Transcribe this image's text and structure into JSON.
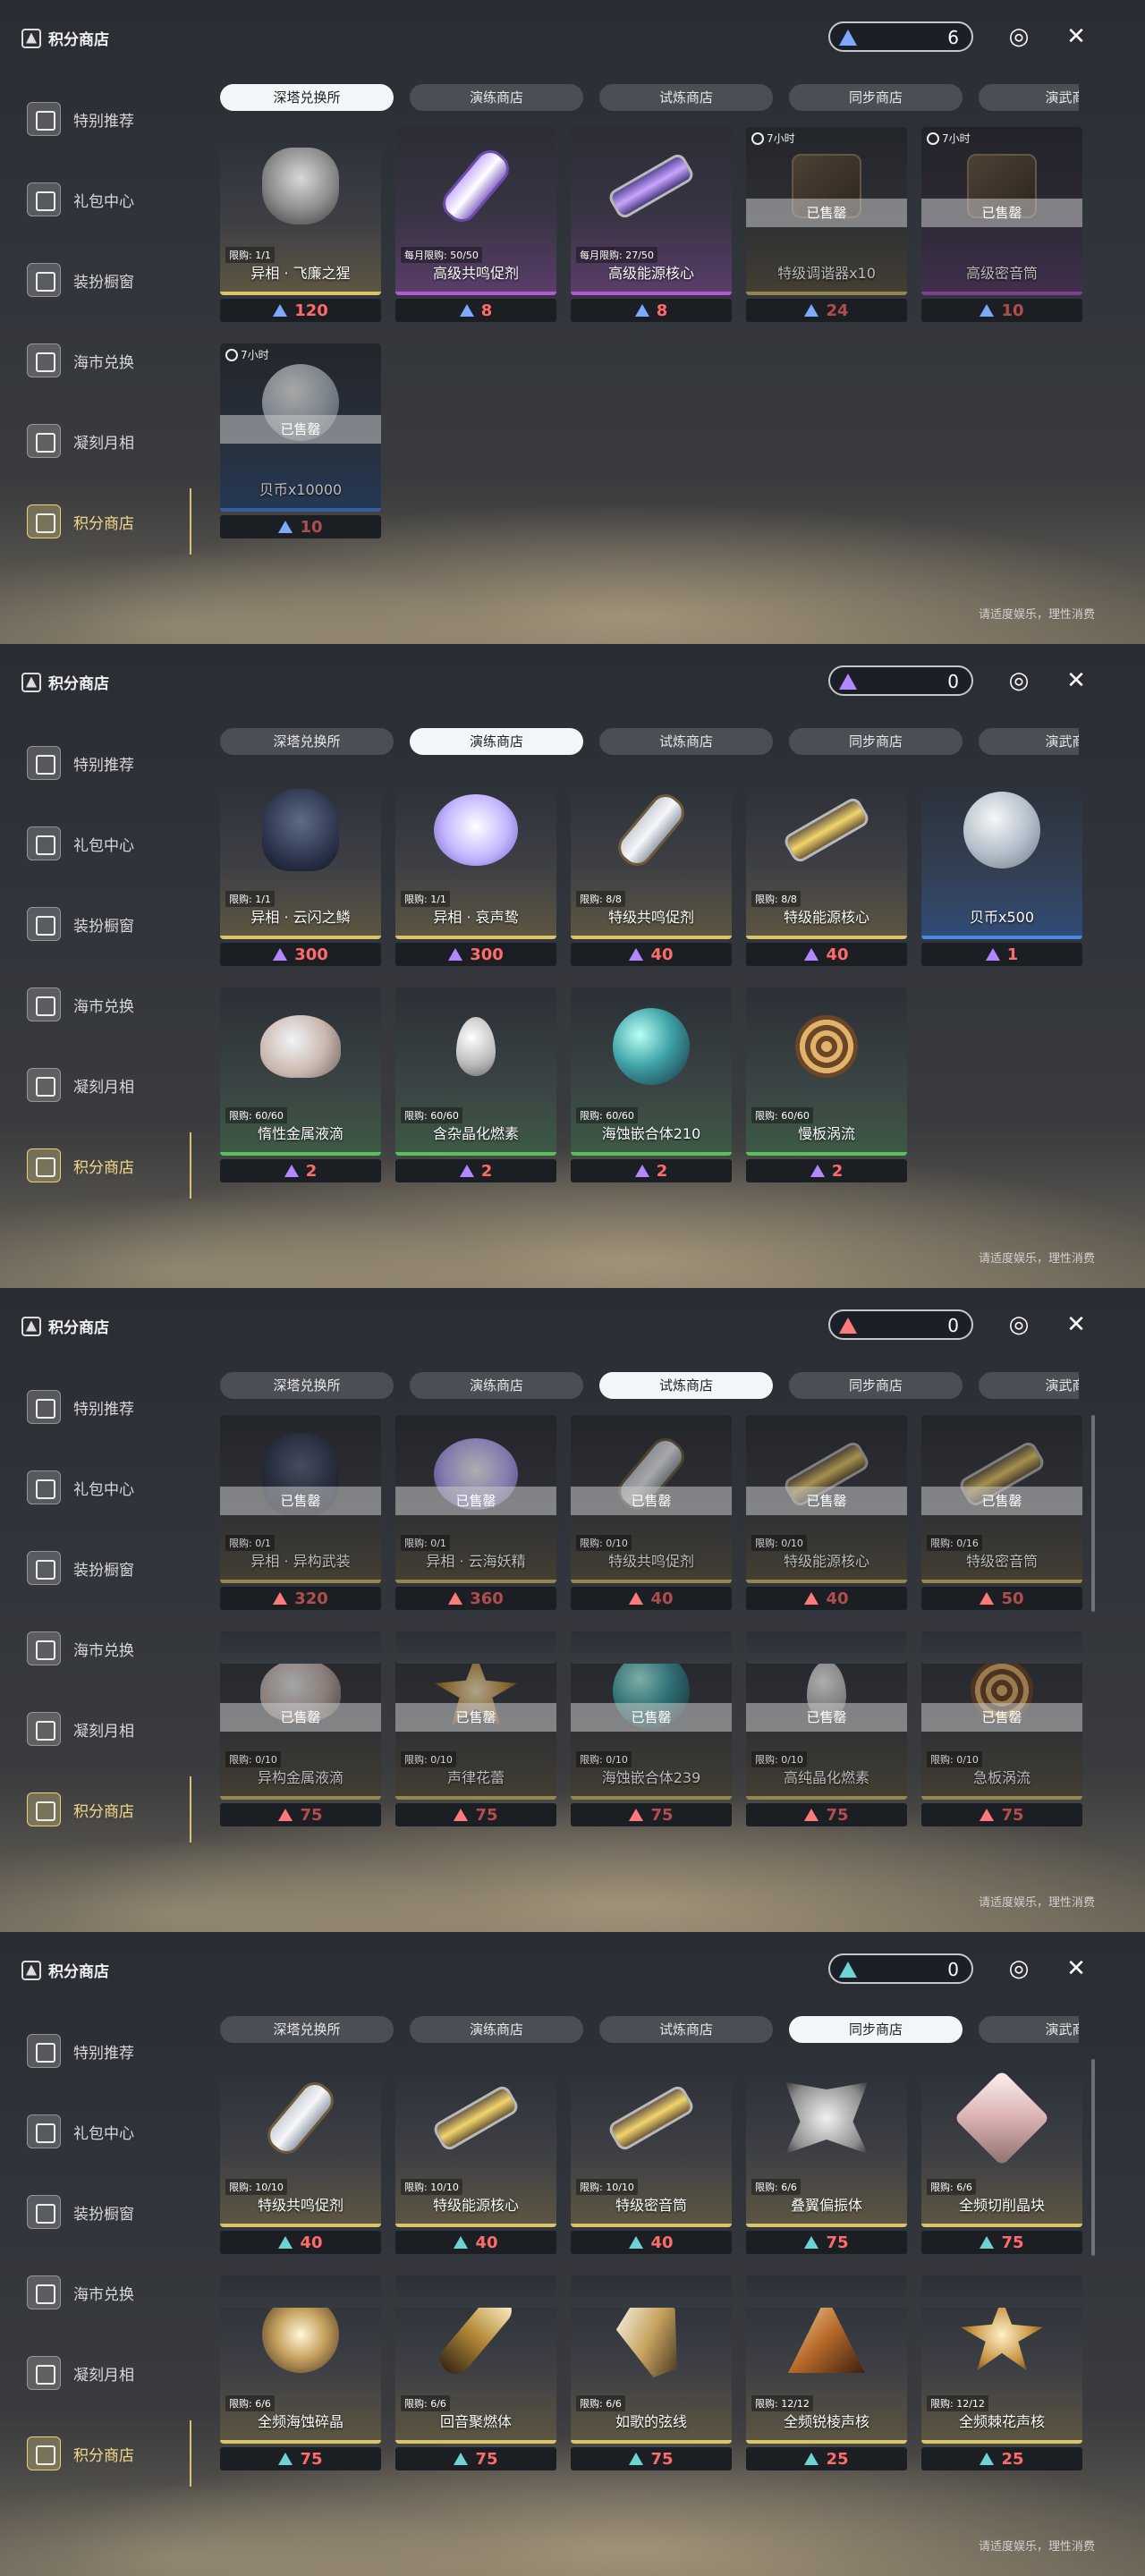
{
  "common": {
    "page_title": "积分商店",
    "notice": "请适度娱乐，理性消费",
    "sidebar": [
      {
        "label": "特别推荐",
        "active": false,
        "icon": "star-icon"
      },
      {
        "label": "礼包中心",
        "active": false,
        "icon": "gift-icon"
      },
      {
        "label": "装扮橱窗",
        "active": false,
        "icon": "wardrobe-icon"
      },
      {
        "label": "海市兑换",
        "active": false,
        "icon": "market-icon"
      },
      {
        "label": "凝刻月相",
        "active": false,
        "icon": "moon-icon"
      },
      {
        "label": "积分商店",
        "active": true,
        "icon": "points-shop-icon"
      }
    ],
    "tabs": [
      "深塔兑换所",
      "演练商店",
      "试炼商店",
      "同步商店",
      "演武商"
    ],
    "sold_label": "已售罄"
  },
  "panels": [
    {
      "currency_value": "6",
      "currency_color": "#7fa8ff",
      "active_tab": 0,
      "items": [
        {
          "name": "异相 · 飞廉之猩",
          "limit": "限购: 1/1",
          "price": "120",
          "art": "mask",
          "rarity": "gold",
          "sold": false
        },
        {
          "name": "高级共鸣促剂",
          "limit": "每月限购: 50/50",
          "price": "8",
          "art": "vial-purple",
          "rarity": "purple",
          "sold": false
        },
        {
          "name": "高级能源核心",
          "limit": "每月限购: 27/50",
          "price": "8",
          "art": "capsule-purple",
          "rarity": "purple",
          "sold": false
        },
        {
          "name": "特级调谐器x10",
          "timer": "7小时",
          "price": "24",
          "art": "box",
          "rarity": "gold",
          "sold": true
        },
        {
          "name": "高级密音筒",
          "timer": "7小时",
          "price": "10",
          "art": "box",
          "rarity": "purple",
          "sold": true
        },
        {
          "name": "贝币x10000",
          "timer": "7小时",
          "price": "10",
          "art": "disc",
          "rarity": "blue",
          "sold": true
        }
      ]
    },
    {
      "currency_value": "0",
      "currency_color": "#b188ff",
      "active_tab": 1,
      "items": [
        {
          "name": "异相 · 云闪之鳞",
          "limit": "限购: 1/1",
          "price": "300",
          "art": "helmet",
          "rarity": "gold",
          "sold": false
        },
        {
          "name": "异相 · 哀声鸷",
          "limit": "限购: 1/1",
          "price": "300",
          "art": "wing",
          "rarity": "gold",
          "sold": false
        },
        {
          "name": "特级共鸣促剂",
          "limit": "限购: 8/8",
          "price": "40",
          "art": "vial",
          "rarity": "gold",
          "sold": false
        },
        {
          "name": "特级能源核心",
          "limit": "限购: 8/8",
          "price": "40",
          "art": "capsule",
          "rarity": "gold",
          "sold": false
        },
        {
          "name": "贝币x500",
          "limit": "",
          "price": "1",
          "art": "disc",
          "rarity": "blue",
          "sold": false
        },
        {
          "name": "惰性金属液滴",
          "limit": "限购: 60/60",
          "price": "2",
          "art": "shell",
          "rarity": "green",
          "sold": false
        },
        {
          "name": "含杂晶化燃素",
          "limit": "限购: 60/60",
          "price": "2",
          "art": "drop",
          "rarity": "green",
          "sold": false
        },
        {
          "name": "海蚀嵌合体210",
          "limit": "限购: 60/60",
          "price": "2",
          "art": "crystal",
          "rarity": "green",
          "sold": false
        },
        {
          "name": "慢板涡流",
          "limit": "限购: 60/60",
          "price": "2",
          "art": "swirl",
          "rarity": "green",
          "sold": false
        }
      ]
    },
    {
      "currency_value": "0",
      "currency_color": "#ff7b7b",
      "active_tab": 2,
      "items": [
        {
          "name": "异相 · 异构武装",
          "limit": "限购: 0/1",
          "price": "320",
          "art": "helmet",
          "rarity": "gold",
          "sold": true
        },
        {
          "name": "异相 · 云海妖精",
          "limit": "限购: 0/1",
          "price": "360",
          "art": "wing",
          "rarity": "gold",
          "sold": true
        },
        {
          "name": "特级共鸣促剂",
          "limit": "限购: 0/10",
          "price": "40",
          "art": "vial",
          "rarity": "gold",
          "sold": true
        },
        {
          "name": "特级能源核心",
          "limit": "限购: 0/10",
          "price": "40",
          "art": "capsule",
          "rarity": "gold",
          "sold": true
        },
        {
          "name": "特级密音筒",
          "limit": "限购: 0/16",
          "price": "50",
          "art": "capsule",
          "rarity": "gold",
          "sold": true
        },
        {
          "name": "异构金属液滴",
          "limit": "限购: 0/10",
          "price": "75",
          "art": "shell",
          "rarity": "gold",
          "sold": true
        },
        {
          "name": "声律花蕾",
          "limit": "限购: 0/10",
          "price": "75",
          "art": "flower",
          "rarity": "gold",
          "sold": true
        },
        {
          "name": "海蚀嵌合体239",
          "limit": "限购: 0/10",
          "price": "75",
          "art": "crystal",
          "rarity": "gold",
          "sold": true
        },
        {
          "name": "高纯晶化燃素",
          "limit": "限购: 0/10",
          "price": "75",
          "art": "drop",
          "rarity": "gold",
          "sold": true
        },
        {
          "name": "急板涡流",
          "limit": "限购: 0/10",
          "price": "75",
          "art": "swirl",
          "rarity": "gold",
          "sold": true
        }
      ]
    },
    {
      "currency_value": "0",
      "currency_color": "#6ed3d3",
      "active_tab": 3,
      "items": [
        {
          "name": "特级共鸣促剂",
          "limit": "限购: 10/10",
          "price": "40",
          "art": "vial",
          "rarity": "gold",
          "sold": false
        },
        {
          "name": "特级能源核心",
          "limit": "限购: 10/10",
          "price": "40",
          "art": "capsule",
          "rarity": "gold",
          "sold": false
        },
        {
          "name": "特级密音筒",
          "limit": "限购: 10/10",
          "price": "40",
          "art": "capsule",
          "rarity": "gold",
          "sold": false
        },
        {
          "name": "叠翼偏振体",
          "limit": "限购: 6/6",
          "price": "75",
          "art": "butterfly",
          "rarity": "gold",
          "sold": false
        },
        {
          "name": "全频切削晶块",
          "limit": "限购: 6/6",
          "price": "75",
          "art": "cube",
          "rarity": "gold",
          "sold": false
        },
        {
          "name": "全频海蚀碎晶",
          "limit": "限购: 6/6",
          "price": "75",
          "art": "spark",
          "rarity": "gold",
          "sold": false
        },
        {
          "name": "回音聚燃体",
          "limit": "限购: 6/6",
          "price": "75",
          "art": "feather",
          "rarity": "gold",
          "sold": false
        },
        {
          "name": "如歌的弦线",
          "limit": "限购: 6/6",
          "price": "75",
          "art": "string",
          "rarity": "gold",
          "sold": false
        },
        {
          "name": "全频锐棱声核",
          "limit": "限购: 12/12",
          "price": "25",
          "art": "tri",
          "rarity": "gold",
          "sold": false
        },
        {
          "name": "全频棘花声核",
          "limit": "限购: 12/12",
          "price": "25",
          "art": "flower",
          "rarity": "gold",
          "sold": false
        }
      ]
    }
  ]
}
